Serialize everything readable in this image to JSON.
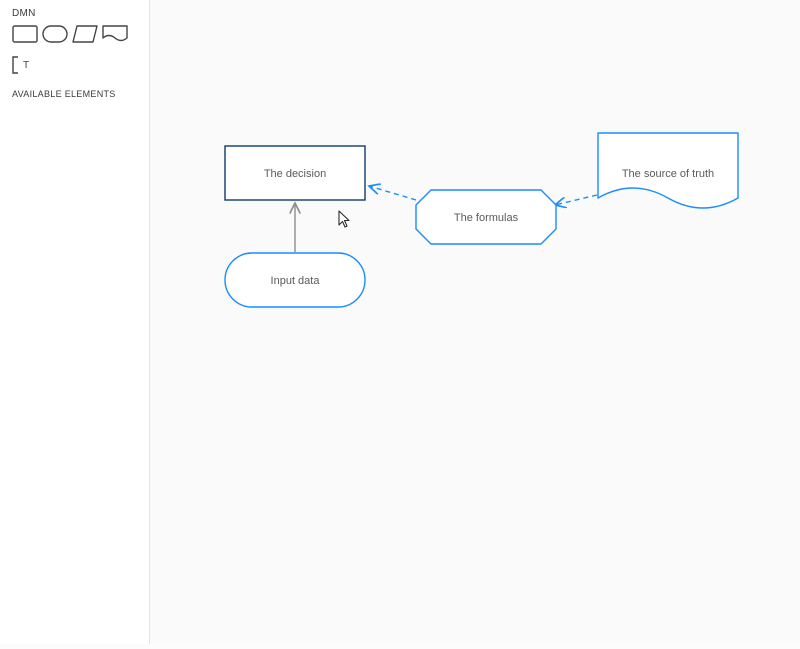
{
  "sidebar": {
    "dmn_label": "DMN",
    "available_elements_label": "AVAILABLE ELEMENTS"
  },
  "palette": {
    "shapes": [
      "decision-rect",
      "input-oval",
      "bkm-box",
      "knowledge-source"
    ],
    "text_annotation_label": "T"
  },
  "nodes": {
    "decision": {
      "label": "The decision"
    },
    "input_data": {
      "label": "Input data"
    },
    "formulas": {
      "label": "The formulas"
    },
    "source_of_truth": {
      "label": "The source of truth"
    }
  },
  "colors": {
    "stroke_navy": "#0f3a6b",
    "stroke_blue": "#1a8cff",
    "fill_white": "#ffffff",
    "sidebar_shape_stroke": "#454545",
    "text": "#5a5a5a",
    "arrow_gray": "#8e8e8e"
  }
}
